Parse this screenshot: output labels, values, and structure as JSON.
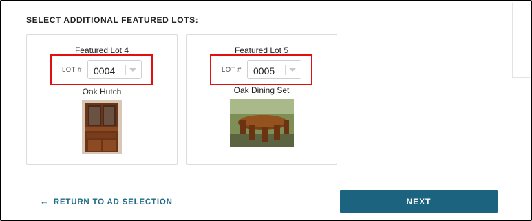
{
  "section": {
    "title": "SELECT ADDITIONAL FEATURED LOTS:"
  },
  "cards": [
    {
      "title": "Featured Lot 4",
      "lot_label": "LOT #",
      "lot_value": "0004",
      "item_name": "Oak Hutch"
    },
    {
      "title": "Featured Lot 5",
      "lot_label": "LOT #",
      "lot_value": "0005",
      "item_name": "Oak Dining Set"
    }
  ],
  "footer": {
    "back_label": "RETURN TO AD SELECTION",
    "next_label": "NEXT"
  },
  "colors": {
    "accent": "#1c6380",
    "link": "#1f6a86",
    "highlight": "#e01010"
  }
}
